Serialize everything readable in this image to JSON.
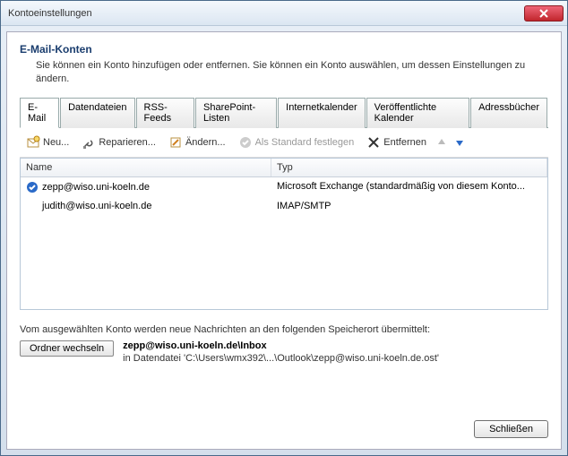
{
  "window": {
    "title": "Kontoeinstellungen"
  },
  "header": {
    "title": "E-Mail-Konten",
    "subtitle": "Sie können ein Konto hinzufügen oder entfernen. Sie können ein Konto auswählen, um dessen Einstellungen zu ändern."
  },
  "tabs": [
    {
      "label": "E-Mail",
      "active": true
    },
    {
      "label": "Datendateien"
    },
    {
      "label": "RSS-Feeds"
    },
    {
      "label": "SharePoint-Listen"
    },
    {
      "label": "Internetkalender"
    },
    {
      "label": "Veröffentlichte Kalender"
    },
    {
      "label": "Adressbücher"
    }
  ],
  "toolbar": {
    "new": "Neu...",
    "repair": "Reparieren...",
    "change": "Ändern...",
    "setdefault": "Als Standard festlegen",
    "remove": "Entfernen"
  },
  "table": {
    "columns": {
      "name": "Name",
      "type": "Typ"
    },
    "rows": [
      {
        "name": "zepp@wiso.uni-koeln.de",
        "type": "Microsoft Exchange (standardmäßig von diesem Konto...",
        "default": true
      },
      {
        "name": "judith@wiso.uni-koeln.de",
        "type": "IMAP/SMTP",
        "default": false
      }
    ]
  },
  "delivery": {
    "intro": "Vom ausgewählten Konto werden neue Nachrichten an den folgenden Speicherort übermittelt:",
    "button": "Ordner wechseln",
    "path": "zepp@wiso.uni-koeln.de\\Inbox",
    "file": "in Datendatei 'C:\\Users\\wmx392\\...\\Outlook\\zepp@wiso.uni-koeln.de.ost'"
  },
  "footer": {
    "close": "Schließen"
  }
}
